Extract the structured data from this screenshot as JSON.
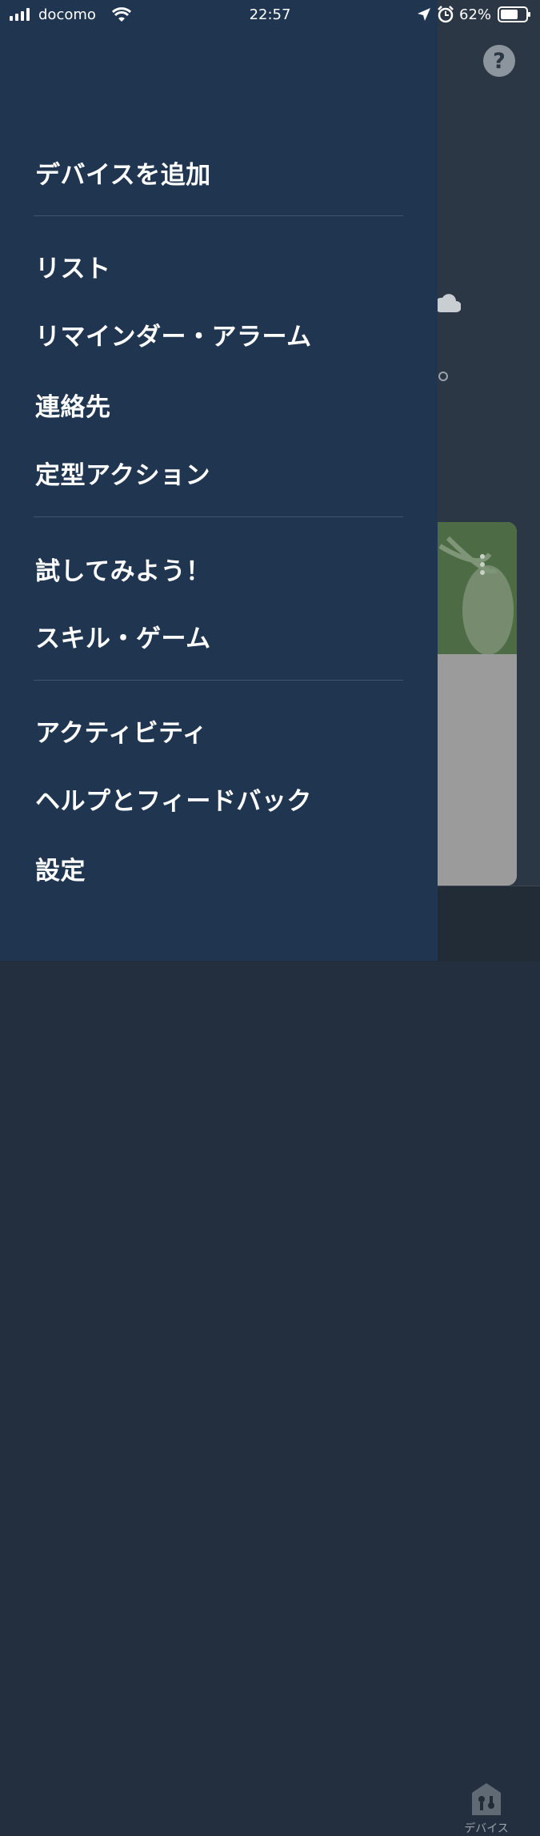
{
  "status_bar": {
    "carrier": "docomo",
    "time": "22:57",
    "battery": "62%"
  },
  "background": {
    "bottom_tab_label": "デバイス"
  },
  "drawer": {
    "sections": [
      {
        "items": [
          {
            "label": "デバイスを追加"
          }
        ]
      },
      {
        "items": [
          {
            "label": "リスト"
          },
          {
            "label": "リマインダー・アラーム"
          },
          {
            "label": "連絡先"
          },
          {
            "label": "定型アクション"
          }
        ]
      },
      {
        "items": [
          {
            "label": "試してみよう！"
          },
          {
            "label": "スキル・ゲーム"
          }
        ]
      },
      {
        "items": [
          {
            "label": "アクティビティ"
          },
          {
            "label": "ヘルプとフィードバック"
          },
          {
            "label": "設定"
          }
        ]
      }
    ]
  },
  "colors": {
    "drawer_bg": "#1f3550",
    "overlay_bg": "#2b3744",
    "divider": "#3e5672",
    "text": "#ffffff"
  }
}
